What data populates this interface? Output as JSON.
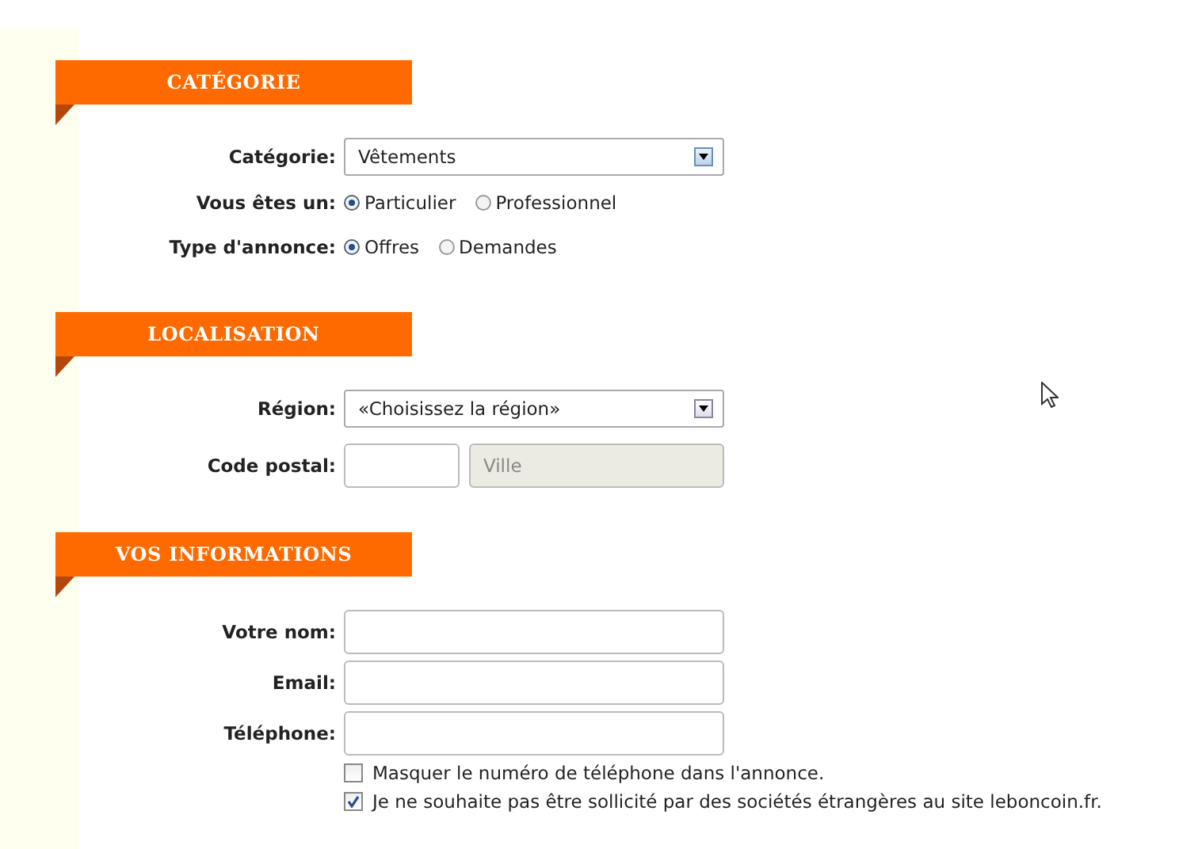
{
  "sections": [
    {
      "title": "CATÉGORIE",
      "rows": [
        {
          "kind": "select",
          "label": "Catégorie:",
          "value": "Vêtements"
        },
        {
          "kind": "radio",
          "label": "Vous êtes un:",
          "options": [
            {
              "label": "Particulier",
              "selected": true
            },
            {
              "label": "Professionnel",
              "selected": false
            }
          ]
        },
        {
          "kind": "radio",
          "label": "Type d'annonce:",
          "options": [
            {
              "label": "Offres",
              "selected": true
            },
            {
              "label": "Demandes",
              "selected": false
            }
          ]
        }
      ]
    },
    {
      "title": "LOCALISATION",
      "rows": [
        {
          "kind": "select",
          "label": "Région:",
          "value": "«Choisissez la région»"
        },
        {
          "kind": "postal",
          "label": "Code postal:",
          "city": {
            "placeholder": "Ville",
            "disabled": true
          }
        }
      ]
    },
    {
      "title": "VOS INFORMATIONS",
      "rows": [
        {
          "kind": "text",
          "label": "Votre nom:"
        },
        {
          "kind": "text",
          "label": "Email:"
        },
        {
          "kind": "text",
          "label": "Téléphone:"
        },
        {
          "kind": "checkbox",
          "label": "Masquer le numéro de téléphone dans l'annonce.",
          "checked": false
        },
        {
          "kind": "checkbox",
          "label": "Je ne souhaite pas être sollicité par des sociétés étrangères au site leboncoin.fr.",
          "checked": true
        }
      ]
    }
  ]
}
